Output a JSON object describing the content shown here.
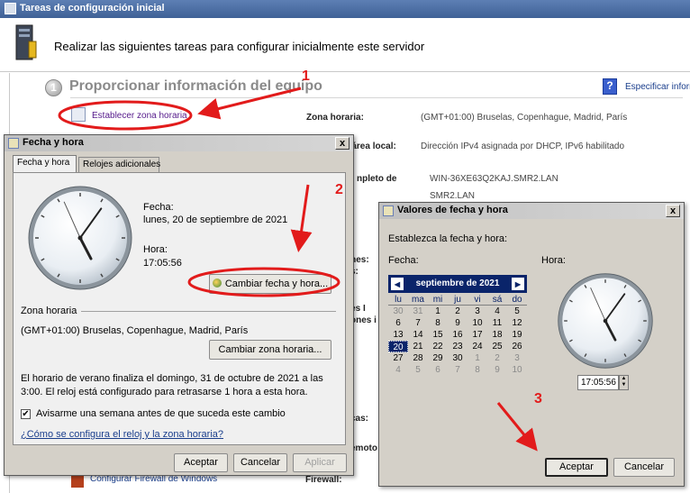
{
  "background_window": {
    "title": "Tareas de configuración inicial",
    "instructions": "Realizar las siguientes tareas para configurar inicialmente este servidor",
    "section_number": "1",
    "section_title": "Proporcionar información del equipo",
    "help_link": "Especificar informa",
    "task_link": "Establecer zona horaria",
    "labels": {
      "zona_horaria": "Zona horaria:",
      "red_local_fragment": "e área local:",
      "nombre_fragment": "npleto de",
      "frag_1": "ones:",
      "frag_2": "s:",
      "frag_3": "nes I",
      "frag_4": "ones i",
      "frag_5": "cas:",
      "frag_6": "emoto"
    },
    "values": {
      "zona_horaria": "(GMT+01:00) Bruselas, Copenhague, Madrid, París",
      "red_local": "Dirección IPv4 asignada por DHCP, IPv6 habilitado",
      "nombre": "WIN-36XE63Q2KAJ.SMR2.LAN",
      "dominio": "SMR2.LAN"
    },
    "firewall_link": "Configurar Firewall de Windows",
    "firewall_label": "Firewall:"
  },
  "dialog_fecha_hora": {
    "title": "Fecha y hora",
    "close": "x",
    "tabs": [
      "Fecha y hora",
      "Relojes adicionales"
    ],
    "fecha_label": "Fecha:",
    "fecha_value": "lunes, 20 de septiembre de 2021",
    "hora_label": "Hora:",
    "hora_value": "17:05:56",
    "cambiar_fecha_button": "Cambiar fecha y hora...",
    "zona_section_label": "Zona horaria",
    "zona_value": "(GMT+01:00) Bruselas, Copenhague, Madrid, París",
    "cambiar_zona_button": "Cambiar zona horaria...",
    "dst_text": "El horario de verano finaliza el domingo, 31 de octubre de 2021 a las 3:00. El reloj está configurado para retrasarse 1 hora a esta hora.",
    "checkbox_checked": true,
    "checkbox_mark": "✔",
    "checkbox_label": "Avisarme una semana antes de que suceda este cambio",
    "help_link": "¿Cómo se configura el reloj y la zona horaria?",
    "ok_button": "Aceptar",
    "cancel_button": "Cancelar",
    "apply_button": "Aplicar"
  },
  "dialog_valores": {
    "title": "Valores de fecha y hora",
    "close": "x",
    "instructions": "Establezca la fecha y hora:",
    "fecha_label": "Fecha:",
    "hora_label": "Hora:",
    "calendar": {
      "month_label": "septiembre de 2021",
      "prev": "◀",
      "next": "▶",
      "weekdays": [
        "lu",
        "ma",
        "mi",
        "ju",
        "vi",
        "sá",
        "do"
      ],
      "weeks": [
        [
          "30",
          "31",
          "1",
          "2",
          "3",
          "4",
          "5"
        ],
        [
          "6",
          "7",
          "8",
          "9",
          "10",
          "11",
          "12"
        ],
        [
          "13",
          "14",
          "15",
          "16",
          "17",
          "18",
          "19"
        ],
        [
          "20",
          "21",
          "22",
          "23",
          "24",
          "25",
          "26"
        ],
        [
          "27",
          "28",
          "29",
          "30",
          "1",
          "2",
          "3"
        ],
        [
          "4",
          "5",
          "6",
          "7",
          "8",
          "9",
          "10"
        ]
      ],
      "selected_day": "20"
    },
    "time_value": "17:05:56",
    "spin_up": "▲",
    "spin_down": "▼",
    "ok_button": "Aceptar",
    "cancel_button": "Cancelar"
  },
  "annotations": {
    "step_1": "1",
    "step_2": "2",
    "step_3": "3",
    "color": "#e21b1b"
  },
  "clock_time": {
    "hour": 17,
    "minute": 5,
    "second": 56
  }
}
